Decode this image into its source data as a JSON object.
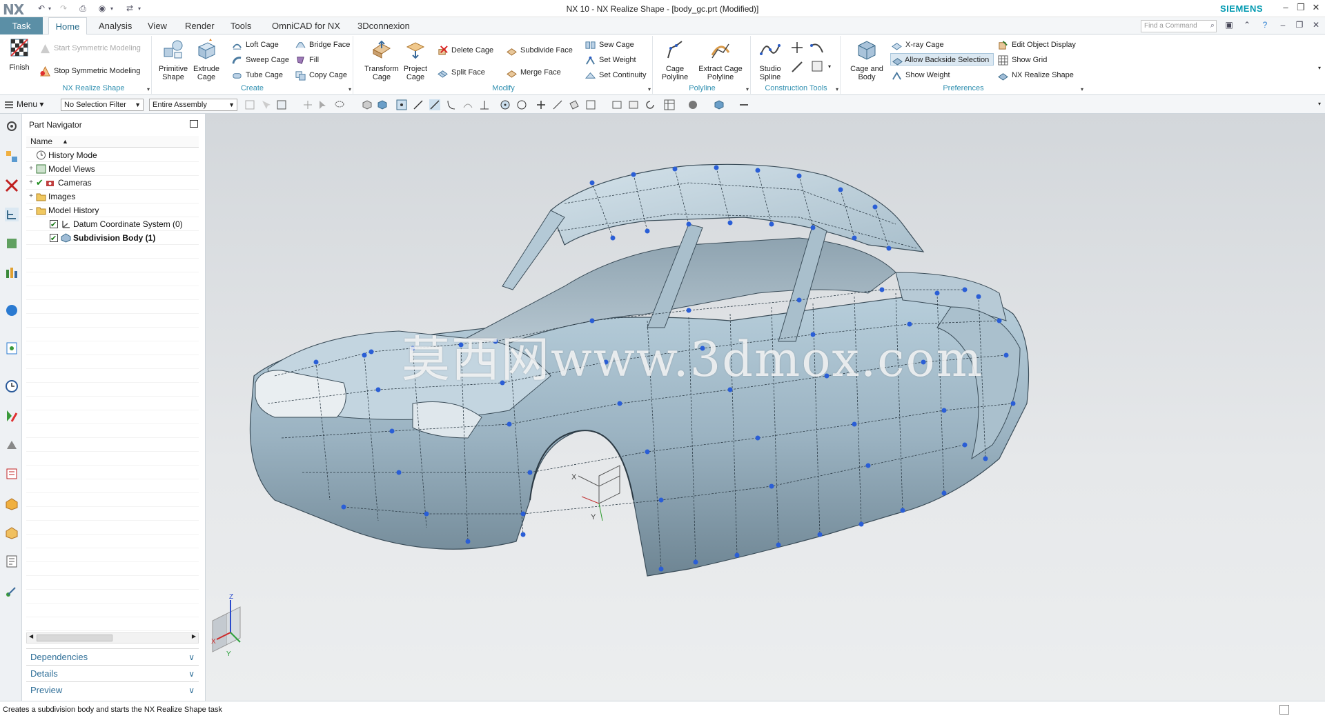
{
  "app": {
    "logo": "NX",
    "title": "NX 10 - NX Realize Shape - [body_gc.prt (Modified)]",
    "brand": "SIEMENS",
    "brand_color": "#0099b0",
    "find_placeholder": "Find a Command"
  },
  "tabs": [
    "Task",
    "Home",
    "Analysis",
    "View",
    "Render",
    "Tools",
    "OmniCAD for NX",
    "3Dconnexion"
  ],
  "active_tab": "Home",
  "ribbon": {
    "finish": "Finish",
    "nx_realize": {
      "label": "NX Realize Shape",
      "start_symmetric": "Start Symmetric Modeling",
      "stop_symmetric": "Stop Symmetric Modeling"
    },
    "create": {
      "label": "Create",
      "primitive_shape": [
        "Primitive",
        "Shape"
      ],
      "extrude_cage": [
        "Extrude",
        "Cage"
      ],
      "loft_cage": "Loft Cage",
      "sweep_cage": "Sweep Cage",
      "tube_cage": "Tube Cage",
      "bridge_face": "Bridge Face",
      "fill": "Fill",
      "copy_cage": "Copy Cage"
    },
    "modify": {
      "label": "Modify",
      "transform_cage": [
        "Transform",
        "Cage"
      ],
      "project_cage": [
        "Project",
        "Cage"
      ],
      "delete_cage": "Delete Cage",
      "split_face": "Split Face",
      "subdivide_face": "Subdivide Face",
      "merge_face": "Merge Face",
      "sew_cage": "Sew Cage",
      "set_weight": "Set Weight",
      "set_continuity": "Set Continuity"
    },
    "polyline": {
      "label": "Polyline",
      "cage_polyline": [
        "Cage",
        "Polyline"
      ],
      "extract_cage_polyline": [
        "Extract Cage",
        "Polyline"
      ]
    },
    "construction": {
      "label": "Construction Tools",
      "studio_spline": [
        "Studio",
        "Spline"
      ]
    },
    "preferences": {
      "label": "Preferences",
      "cage_and_body": [
        "Cage and",
        "Body"
      ],
      "xray_cage": "X-ray Cage",
      "allow_backside": "Allow Backside Selection",
      "show_weight": "Show Weight",
      "edit_object_display": "Edit Object Display",
      "show_grid": "Show Grid",
      "nx_realize_shape": "NX Realize Shape"
    }
  },
  "toolbar": {
    "menu": "Menu",
    "selection_filter": "No Selection Filter",
    "assembly": "Entire Assembly"
  },
  "navigator": {
    "title": "Part Navigator",
    "column": "Name",
    "items": [
      {
        "label": "History Mode",
        "level": 0
      },
      {
        "label": "Model Views",
        "level": 0
      },
      {
        "label": "Cameras",
        "level": 0
      },
      {
        "label": "Images",
        "level": 0
      },
      {
        "label": "Model History",
        "level": 0
      },
      {
        "label": "Datum Coordinate System (0)",
        "level": 1
      },
      {
        "label": "Subdivision Body (1)",
        "level": 1
      }
    ],
    "sections": [
      "Dependencies",
      "Details",
      "Preview"
    ]
  },
  "viewport": {
    "watermark": "莫西网www.3dmox.com",
    "triad": {
      "x": "X",
      "y": "Y",
      "z": "Z"
    }
  },
  "status": {
    "text": "Creates a subdivision body and starts the NX Realize Shape task"
  }
}
